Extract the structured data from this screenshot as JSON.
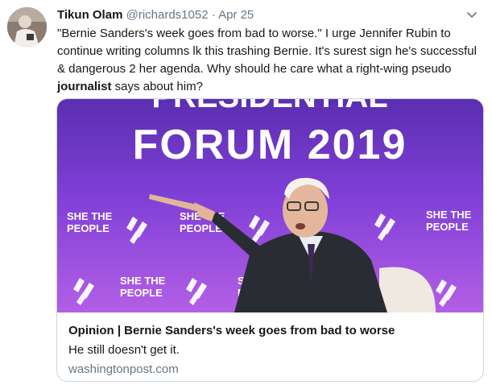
{
  "tweet": {
    "author_name": "Tikun Olam",
    "author_handle": "@richards1052",
    "separator": "·",
    "date": "Apr 25",
    "text_part1": "\"Bernie Sanders's week goes from bad to worse.\" I urge Jennifer Rubin to continue writing columns lk this trashing Bernie. It's  surest sign he's successful & dangerous 2 her agenda.  Why should he care what a right-wing pseudo ",
    "text_bold": "journalist",
    "text_part2": " says about him?"
  },
  "card": {
    "title": "Opinion | Bernie Sanders's week goes from bad to worse",
    "description": "He still doesn't get it.",
    "domain": "washingtonpost.com",
    "image": {
      "banner_text": "FORUM 2019",
      "sign_line1": "SHE THE",
      "sign_line2": "PEOPLE",
      "top_partial": "PRESIDENTIAL"
    }
  },
  "colors": {
    "banner_purple": "#7f3fd6",
    "banner_dark": "#5b2eb0",
    "link_gray": "#657786",
    "border": "#ccd6dd"
  }
}
